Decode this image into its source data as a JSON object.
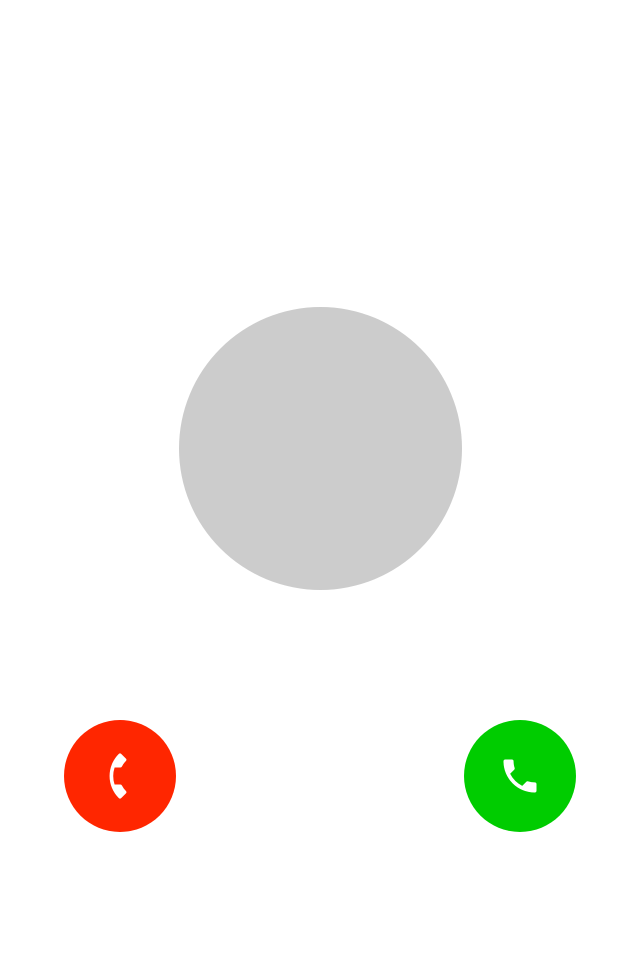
{
  "caller": {
    "avatar_color": "#cccccc"
  },
  "actions": {
    "decline": {
      "icon": "phone-hangup-icon",
      "color": "#ff2600"
    },
    "accept": {
      "icon": "phone-icon",
      "color": "#00cc00"
    }
  }
}
